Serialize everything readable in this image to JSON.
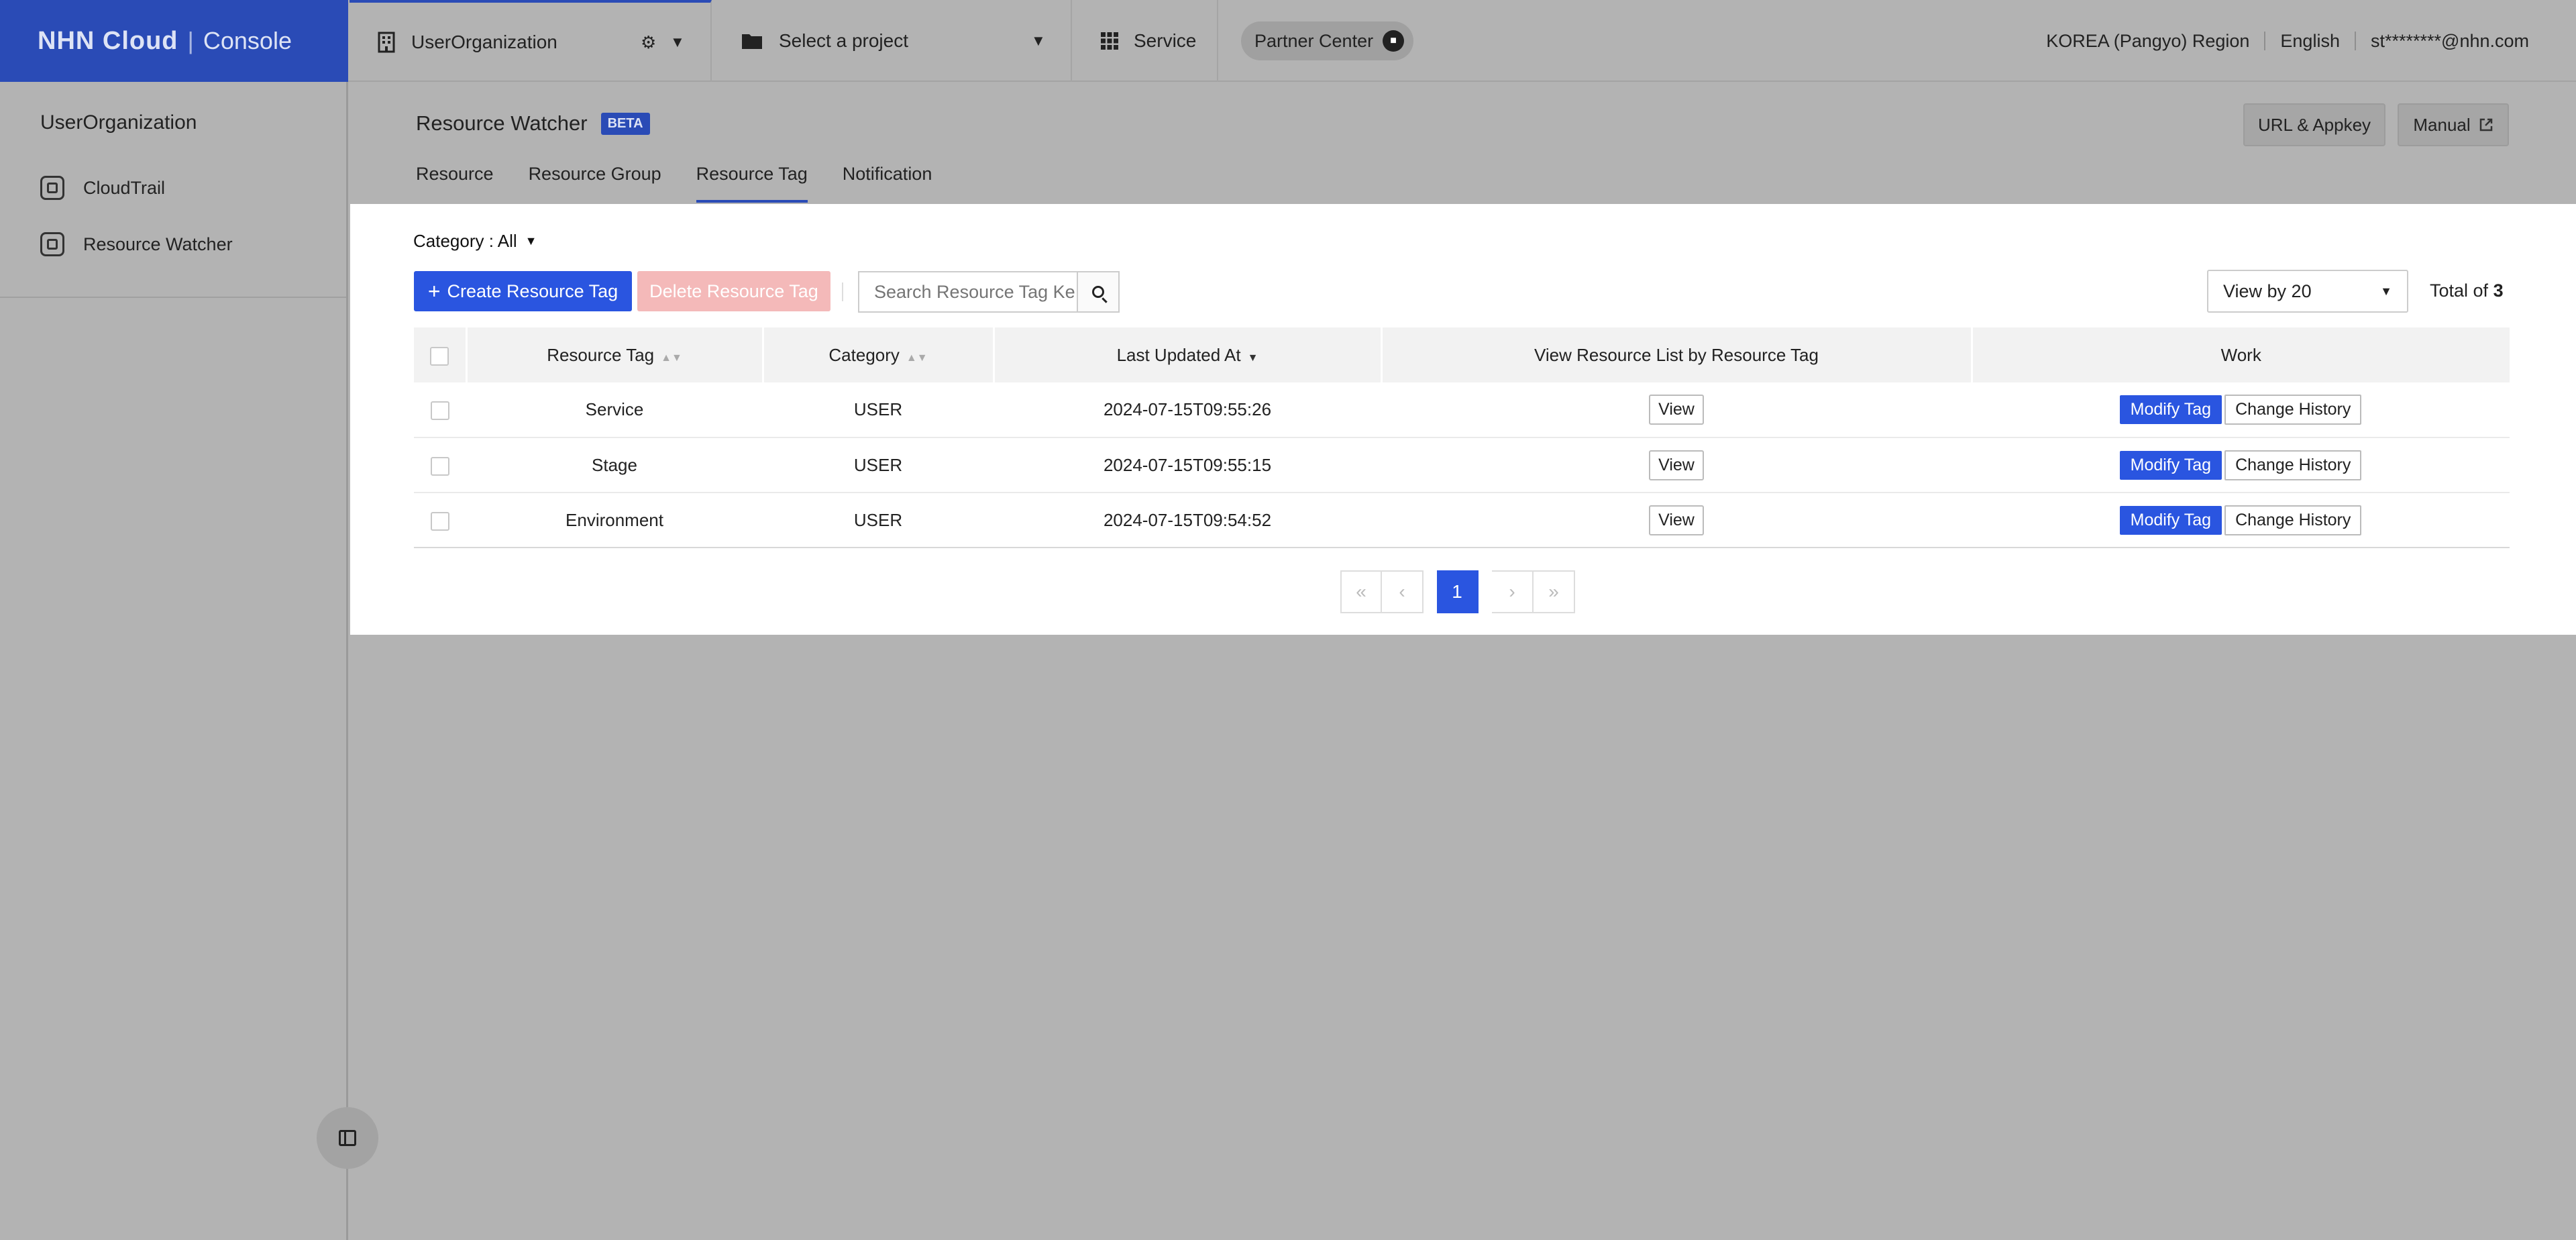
{
  "topbar": {
    "brand_logo": "NHN Cloud",
    "brand_sep": "|",
    "brand_console": "Console",
    "organization": "UserOrganization",
    "project": "Select a project",
    "service": "Service",
    "partner": "Partner Center",
    "region": "KOREA (Pangyo) Region",
    "language": "English",
    "user": "st********@nhn.com"
  },
  "sidebar": {
    "title": "UserOrganization",
    "items": [
      {
        "label": "CloudTrail"
      },
      {
        "label": "Resource Watcher"
      }
    ]
  },
  "page": {
    "title": "Resource Watcher",
    "badge": "BETA",
    "url_button": "URL & Appkey",
    "manual_button": "Manual",
    "tabs": [
      {
        "label": "Resource"
      },
      {
        "label": "Resource Group"
      },
      {
        "label": "Resource Tag"
      },
      {
        "label": "Notification"
      }
    ]
  },
  "toolbar": {
    "category_filter": "Category : All",
    "create_label": "Create Resource Tag",
    "delete_label": "Delete Resource Tag",
    "search_placeholder": "Search Resource Tag Ke",
    "view_by": "View by 20",
    "total_prefix": "Total of ",
    "total_count": "3"
  },
  "table": {
    "headers": [
      "Resource Tag",
      "Category",
      "Last Updated At",
      "View Resource List by Resource Tag",
      "Work"
    ],
    "rows": [
      {
        "tag": "Service",
        "category": "USER",
        "updated": "2024-07-15T09:55:26",
        "view": "View",
        "modify": "Modify Tag",
        "history": "Change History"
      },
      {
        "tag": "Stage",
        "category": "USER",
        "updated": "2024-07-15T09:55:15",
        "view": "View",
        "modify": "Modify Tag",
        "history": "Change History"
      },
      {
        "tag": "Environment",
        "category": "USER",
        "updated": "2024-07-15T09:54:52",
        "view": "View",
        "modify": "Modify Tag",
        "history": "Change History"
      }
    ]
  },
  "pagination": {
    "first": "«",
    "prev": "‹",
    "current": "1",
    "next": "›",
    "last": "»"
  },
  "colors": {
    "brand": "#2a4bb6",
    "primary_button": "#2a55e0",
    "disabled_button": "#f4b9b9",
    "overlay": "#b3b3b3"
  }
}
